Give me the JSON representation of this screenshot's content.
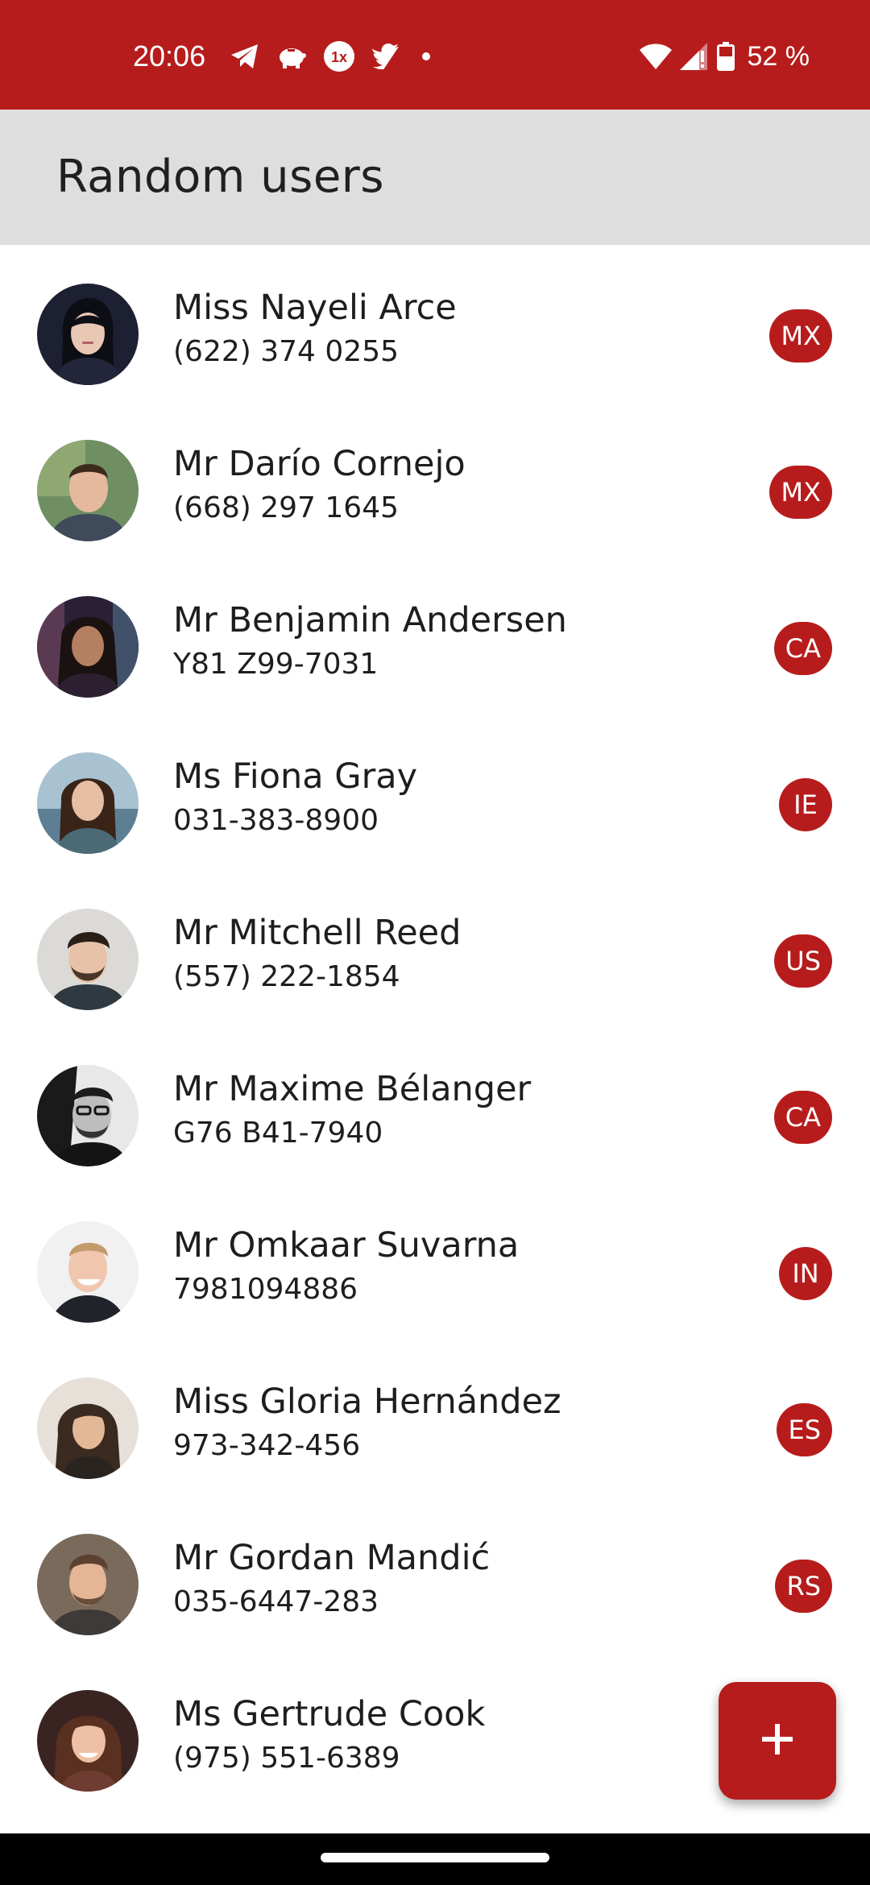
{
  "status_bar": {
    "time": "20:06",
    "battery": "52 %",
    "background_color": "#b71c1c",
    "left_icons": [
      "telegram-icon",
      "piggy-bank-icon",
      "1x-icon",
      "twitter-icon",
      "dot-icon"
    ],
    "right_icons": [
      "wifi-icon",
      "signal-icon",
      "battery-icon"
    ]
  },
  "app_bar": {
    "title": "Random users",
    "background_color": "#dedede"
  },
  "users": [
    {
      "name": "Miss Nayeli Arce",
      "phone": "(622) 374 0255",
      "country": "MX"
    },
    {
      "name": "Mr Darío Cornejo",
      "phone": "(668) 297 1645",
      "country": "MX"
    },
    {
      "name": "Mr Benjamin Andersen",
      "phone": "Y81 Z99-7031",
      "country": "CA"
    },
    {
      "name": "Ms Fiona Gray",
      "phone": "031-383-8900",
      "country": "IE"
    },
    {
      "name": "Mr Mitchell Reed",
      "phone": "(557) 222-1854",
      "country": "US"
    },
    {
      "name": "Mr Maxime Bélanger",
      "phone": "G76 B41-7940",
      "country": "CA"
    },
    {
      "name": "Mr Omkaar Suvarna",
      "phone": "7981094886",
      "country": "IN"
    },
    {
      "name": "Miss Gloria Hernández",
      "phone": "973-342-456",
      "country": "ES"
    },
    {
      "name": "Mr Gordan Mandić",
      "phone": "035-6447-283",
      "country": "RS"
    },
    {
      "name": "Ms Gertrude Cook",
      "phone": "(975) 551-6389",
      "country": ""
    }
  ],
  "fab": {
    "icon": "plus-icon",
    "color": "#b71c1c"
  },
  "accent_color": "#b71c1c"
}
